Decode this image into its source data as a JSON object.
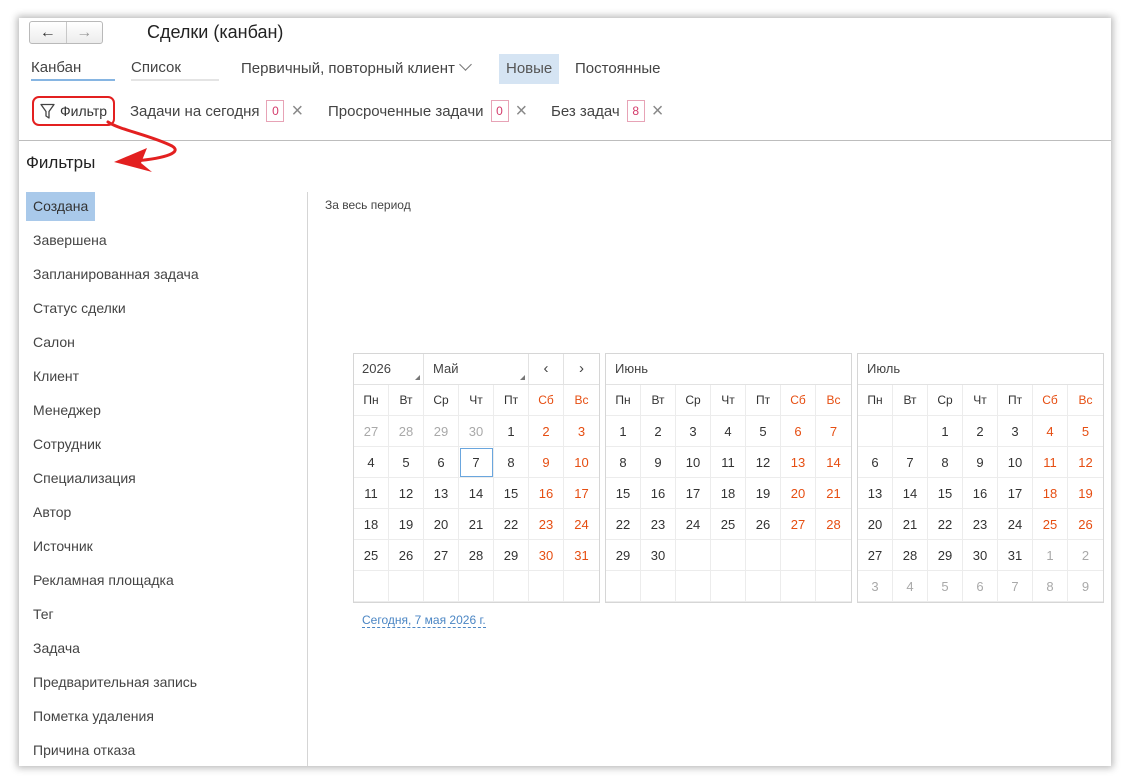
{
  "header": {
    "title": "Сделки (канбан)",
    "back_icon": "←",
    "forward_icon": "→"
  },
  "tabs": [
    {
      "label": "Канбан",
      "active": true
    },
    {
      "label": "Список",
      "active": false
    }
  ],
  "client_type": {
    "label": "Первичный, повторный клиент"
  },
  "segments": [
    {
      "label": "Новые",
      "active": true
    },
    {
      "label": "Постоянные",
      "active": false
    }
  ],
  "toolbar": {
    "filter_label": "Фильтр",
    "chips": [
      {
        "label": "Задачи на сегодня",
        "count": "0"
      },
      {
        "label": "Просроченные задачи",
        "count": "0"
      },
      {
        "label": "Без задач",
        "count": "8"
      }
    ]
  },
  "filters": {
    "title": "Фильтры",
    "items": [
      "Создана",
      "Завершена",
      "Запланированная задача",
      "Статус сделки",
      "Салон",
      "Клиент",
      "Менеджер",
      "Сотрудник",
      "Специализация",
      "Автор",
      "Источник",
      "Рекламная площадка",
      "Тег",
      "Задача",
      "Предварительная запись",
      "Пометка удаления",
      "Причина отказа"
    ],
    "active_index": 0
  },
  "period": {
    "label": "За весь период"
  },
  "calendar": {
    "year": "2026",
    "weekdays": [
      "Пн",
      "Вт",
      "Ср",
      "Чт",
      "Пт",
      "Сб",
      "Вс"
    ],
    "prev_icon": "‹",
    "next_icon": "›",
    "months": [
      {
        "name": "Май",
        "days": [
          "27",
          "28",
          "29",
          "30",
          "1",
          "2",
          "3",
          "4",
          "5",
          "6",
          "7",
          "8",
          "9",
          "10",
          "11",
          "12",
          "13",
          "14",
          "15",
          "16",
          "17",
          "18",
          "19",
          "20",
          "21",
          "22",
          "23",
          "24",
          "25",
          "26",
          "27",
          "28",
          "29",
          "30",
          "31",
          "",
          "",
          "",
          "",
          "",
          "",
          ""
        ],
        "first": 4,
        "last": 34,
        "today_index": 10
      },
      {
        "name": "Июнь",
        "days": [
          "1",
          "2",
          "3",
          "4",
          "5",
          "6",
          "7",
          "8",
          "9",
          "10",
          "11",
          "12",
          "13",
          "14",
          "15",
          "16",
          "17",
          "18",
          "19",
          "20",
          "21",
          "22",
          "23",
          "24",
          "25",
          "26",
          "27",
          "28",
          "29",
          "30",
          "",
          "",
          "",
          "",
          "",
          "",
          "",
          "",
          "",
          "",
          "",
          ""
        ],
        "first": 0,
        "last": 29,
        "today_index": -1
      },
      {
        "name": "Июль",
        "days": [
          "",
          "",
          "1",
          "2",
          "3",
          "4",
          "5",
          "6",
          "7",
          "8",
          "9",
          "10",
          "11",
          "12",
          "13",
          "14",
          "15",
          "16",
          "17",
          "18",
          "19",
          "20",
          "21",
          "22",
          "23",
          "24",
          "25",
          "26",
          "27",
          "28",
          "29",
          "30",
          "31",
          "1",
          "2",
          "3",
          "4",
          "5",
          "6",
          "7",
          "8",
          "9"
        ],
        "first": 2,
        "last": 32,
        "today_index": -1
      }
    ],
    "today_link": "Сегодня, 7 мая 2026 г."
  },
  "colors": {
    "accent": "#86b5e2",
    "weekend": "#e64e12",
    "highlight": "#e32020"
  }
}
